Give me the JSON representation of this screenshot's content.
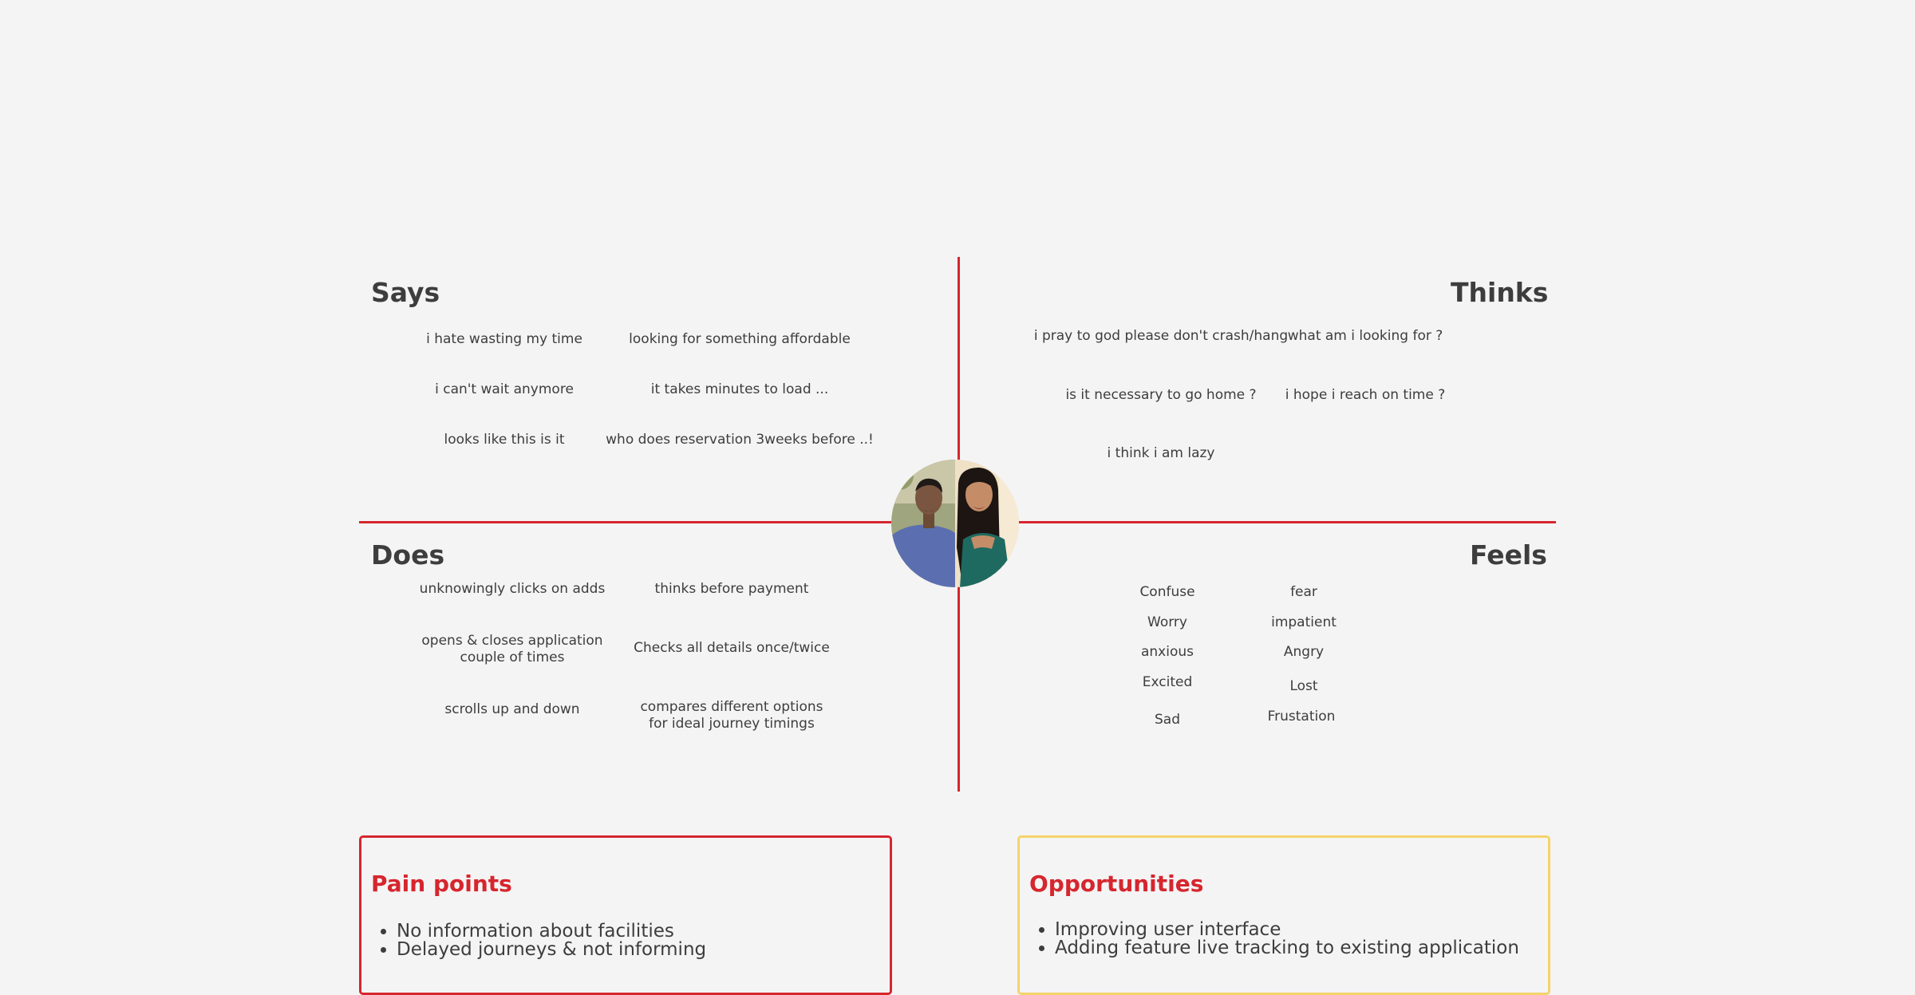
{
  "says": {
    "title": "Says",
    "notes": [
      "i hate wasting my time",
      "looking for something affordable",
      "i can't wait anymore",
      "it takes minutes to load ...",
      "looks like this is it",
      "who does reservation 3weeks before ..!"
    ]
  },
  "thinks": {
    "title": "Thinks",
    "notes": [
      "i pray to god please don't crash/hang",
      "what am i looking for ?",
      "is it necessary to go home ?",
      "i hope i reach on time ?",
      "i think i am lazy"
    ]
  },
  "does": {
    "title": "Does",
    "notes": [
      "unknowingly clicks on adds",
      "thinks before payment",
      "opens & closes application couple of times",
      "Checks all details once/twice",
      "scrolls up and down",
      "compares different options for ideal journey timings"
    ]
  },
  "feels": {
    "title": "Feels",
    "notes": [
      "Confuse",
      "fear",
      "Worry",
      "impatient",
      "anxious",
      "Angry",
      "Excited",
      "Lost",
      "Sad",
      "Frustation"
    ]
  },
  "pain_points": {
    "title": "Pain points",
    "items": [
      "No information about facilities",
      "Delayed journeys & not informing"
    ]
  },
  "opportunities": {
    "title": "Opportunities",
    "items": [
      "Improving user interface",
      "Adding feature live tracking to existing application"
    ]
  },
  "colors": {
    "accent_red": "#d6262e",
    "accent_yellow": "#f5d36b",
    "background": "#f4f4f4",
    "text": "#3d3d3d"
  }
}
